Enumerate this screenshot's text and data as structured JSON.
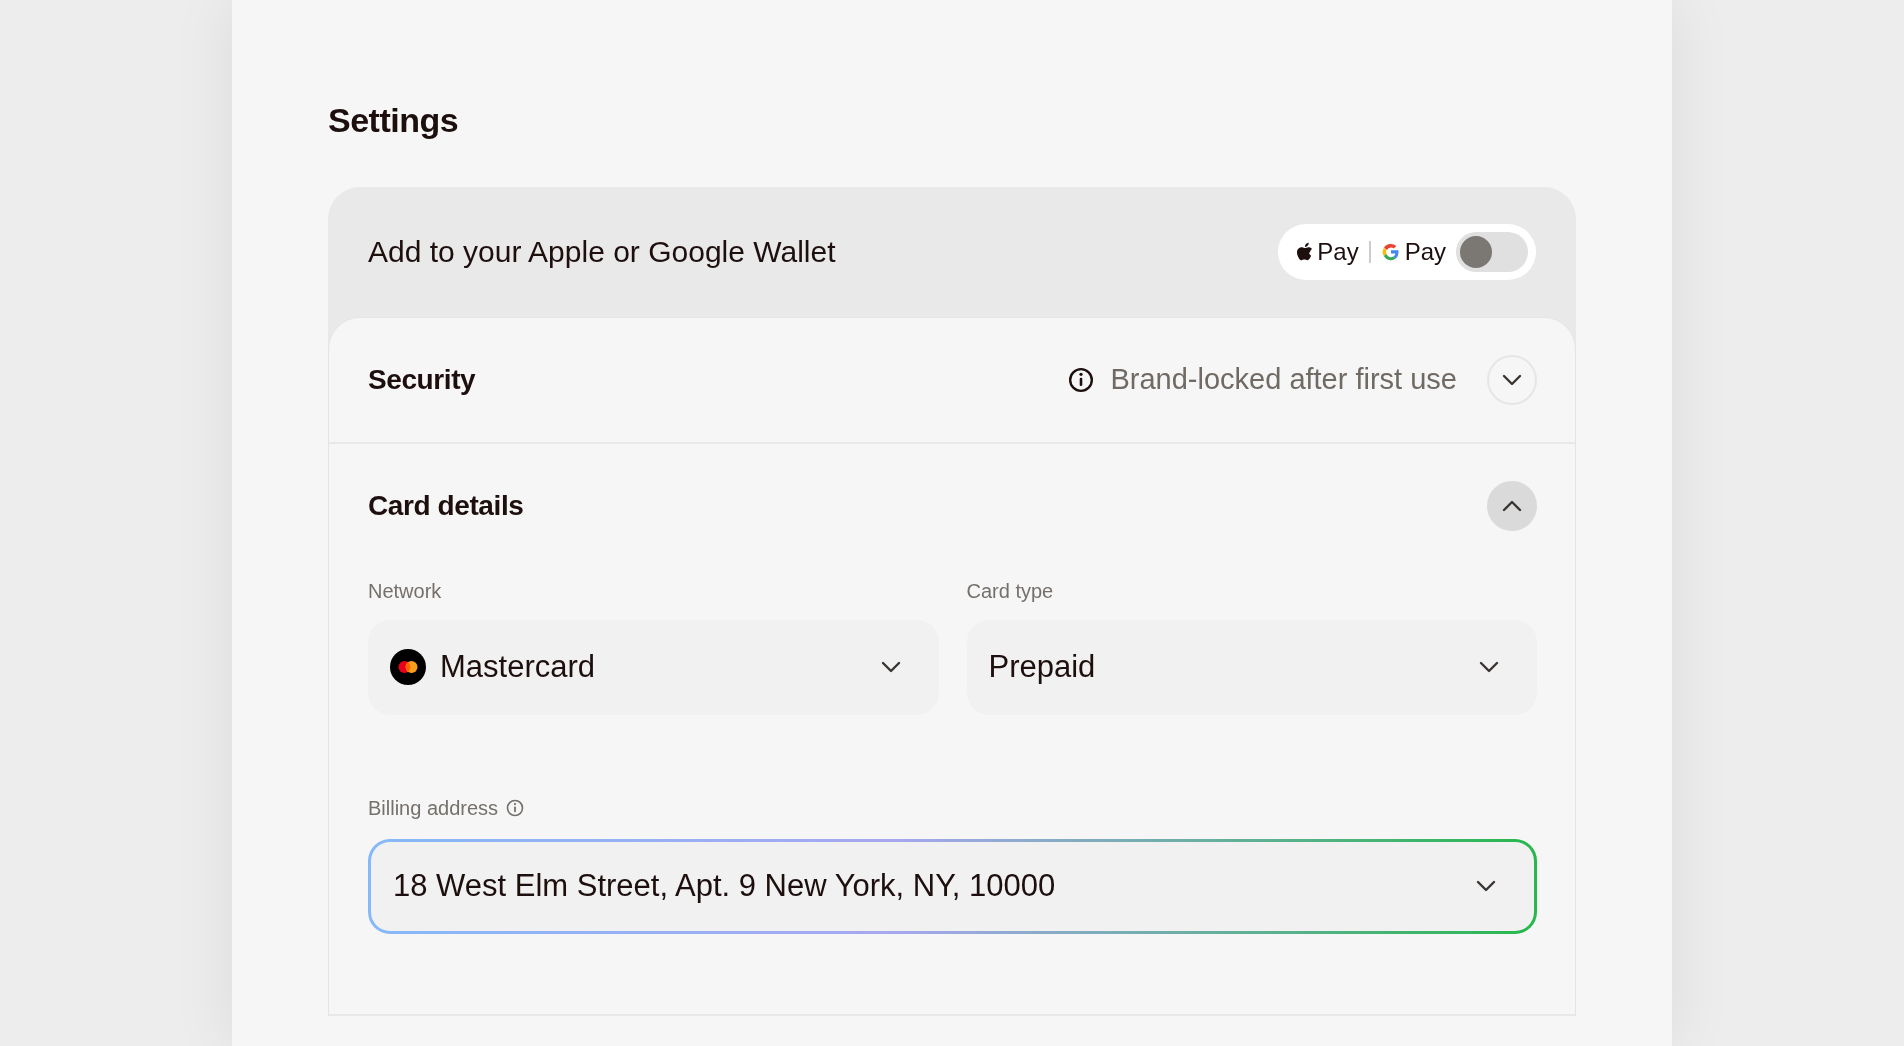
{
  "title": "Settings",
  "wallet": {
    "label": "Add to your Apple or Google Wallet",
    "apple_pay": "Pay",
    "google_pay": "Pay",
    "on": false
  },
  "sections": [
    {
      "title": "Security",
      "note": "Brand-locked after first use",
      "expanded": false
    },
    {
      "title": "Card details",
      "expanded": true,
      "fields": [
        {
          "label": "Network",
          "value": "Mastercard",
          "logo": true
        },
        {
          "label": "Card type",
          "value": "Prepaid",
          "logo": false
        }
      ],
      "address": {
        "label": "Billing address",
        "info": true,
        "value": "18 West Elm Street, Apt. 9 New York, NY, 10000",
        "focused": true
      }
    }
  ]
}
